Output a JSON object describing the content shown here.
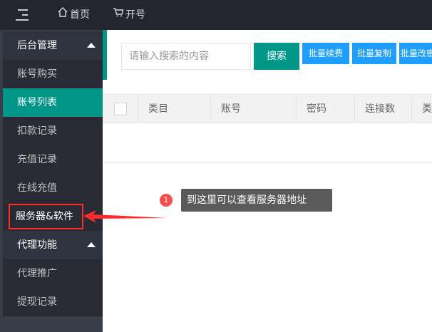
{
  "topbar": {
    "home_label": "首页",
    "open_label": "开号"
  },
  "sidebar": {
    "groups": [
      {
        "label": "后台管理"
      },
      {
        "label": "代理功能"
      }
    ],
    "items": [
      {
        "label": "账号购买"
      },
      {
        "label": "账号列表"
      },
      {
        "label": "扣款记录"
      },
      {
        "label": "充值记录"
      },
      {
        "label": "在线充值"
      },
      {
        "label": "服务器&软件"
      },
      {
        "label": "代理推广"
      },
      {
        "label": "提现记录"
      }
    ]
  },
  "toolbar": {
    "search_placeholder": "请输入搜索的内容",
    "search_button": "搜索",
    "batch_renew": "批量续费",
    "batch_copy": "批量复制",
    "batch_edit": "批量改密"
  },
  "table": {
    "headers": [
      "类目",
      "账号",
      "密码",
      "连接数",
      "类型"
    ]
  },
  "annotation": {
    "badge": "1",
    "text": "到这里可以查看服务器地址"
  },
  "colors": {
    "accent": "#009688",
    "blue": "#1e9fff",
    "topbar": "#23262e",
    "sidebar": "#393d49",
    "highlight": "#ff2a2a"
  }
}
